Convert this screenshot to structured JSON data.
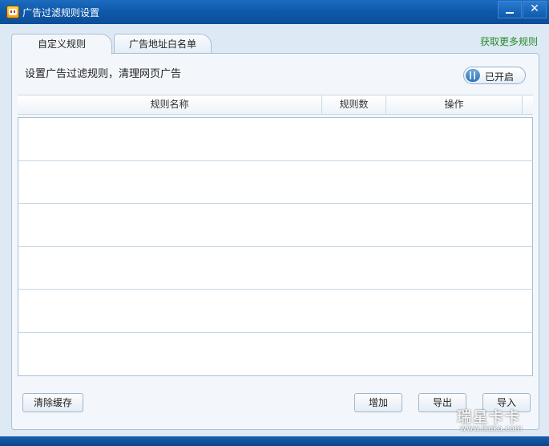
{
  "window": {
    "title": "广告过滤规则设置",
    "icon": "app-logo-icon"
  },
  "tabs": [
    {
      "label": "自定义规则",
      "active": true
    },
    {
      "label": "广告地址白名单",
      "active": false
    }
  ],
  "more_rules_link": "获取更多规则",
  "panel": {
    "description": "设置广告过滤规则，清理网页广告",
    "toggle_label": "已开启",
    "toggle_on": true
  },
  "table": {
    "columns": [
      "规则名称",
      "规则数",
      "操作"
    ],
    "rows": []
  },
  "buttons": {
    "clear_cache": "清除缓存",
    "add": "增加",
    "export": "导出",
    "import": "导入"
  },
  "watermark": {
    "main": "瑞星卡卡",
    "sub": "www.ikaka.com"
  },
  "colors": {
    "titlebar": "#0f5aab",
    "link": "#2b8a2b",
    "panel_bg": "#f3f7fb"
  }
}
